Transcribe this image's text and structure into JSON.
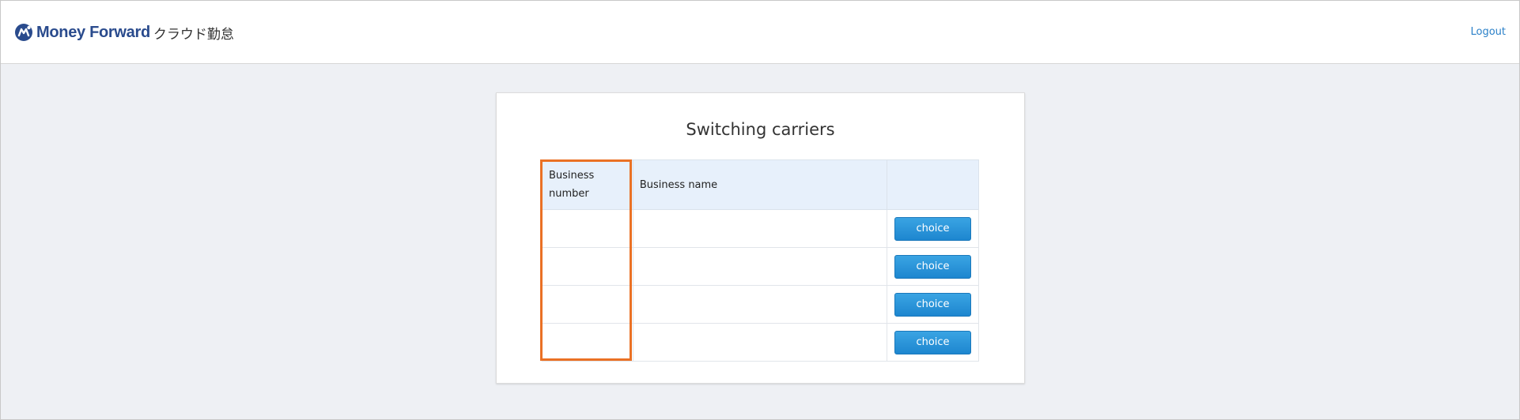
{
  "header": {
    "brand": "Money Forward",
    "product": "クラウド勤怠",
    "logout_label": "Logout"
  },
  "card": {
    "title": "Switching carriers"
  },
  "table": {
    "headers": {
      "business_number": "Business\nnumber",
      "business_name": "Business name",
      "action": ""
    },
    "rows": [
      {
        "number": "",
        "name": "",
        "action_label": "choice"
      },
      {
        "number": "",
        "name": "",
        "action_label": "choice"
      },
      {
        "number": "",
        "name": "",
        "action_label": "choice"
      },
      {
        "number": "",
        "name": "",
        "action_label": "choice"
      }
    ]
  },
  "colors": {
    "header_bg": "#ffffff",
    "page_bg": "#eef0f4",
    "brand_text": "#2a4b8d",
    "link": "#2a80c8",
    "table_header_bg": "#e7f0fb",
    "button": "#1d86cf",
    "highlight": "#ea7125"
  },
  "icons": {
    "logo": "money-forward-logo-icon"
  }
}
